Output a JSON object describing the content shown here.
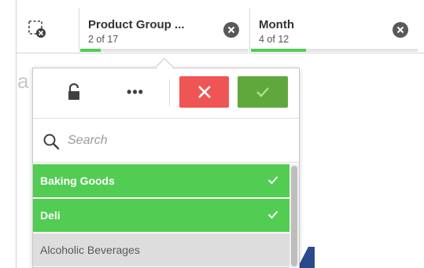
{
  "selections": [
    {
      "title": "Product Group ...",
      "count": "2 of 17",
      "progress": 0.12
    },
    {
      "title": "Month",
      "count": "4 of 12",
      "progress": 0.33
    }
  ],
  "background": {
    "text": "a"
  },
  "popover": {
    "more_label": "•••",
    "search": {
      "placeholder": "Search",
      "value": ""
    },
    "items": [
      {
        "label": "Baking Goods",
        "state": "selected"
      },
      {
        "label": "Deli",
        "state": "selected"
      },
      {
        "label": "Alcoholic Beverages",
        "state": "excluded"
      }
    ]
  },
  "colors": {
    "selected": "#52cc52",
    "excluded": "#dddddd",
    "cancel": "#f05555",
    "confirm": "#5fa93c"
  },
  "icons": {
    "clear_all": "clear-selections-icon",
    "lock": "unlock-icon",
    "cancel": "close-icon",
    "confirm": "checkmark-icon",
    "search": "search-icon"
  }
}
